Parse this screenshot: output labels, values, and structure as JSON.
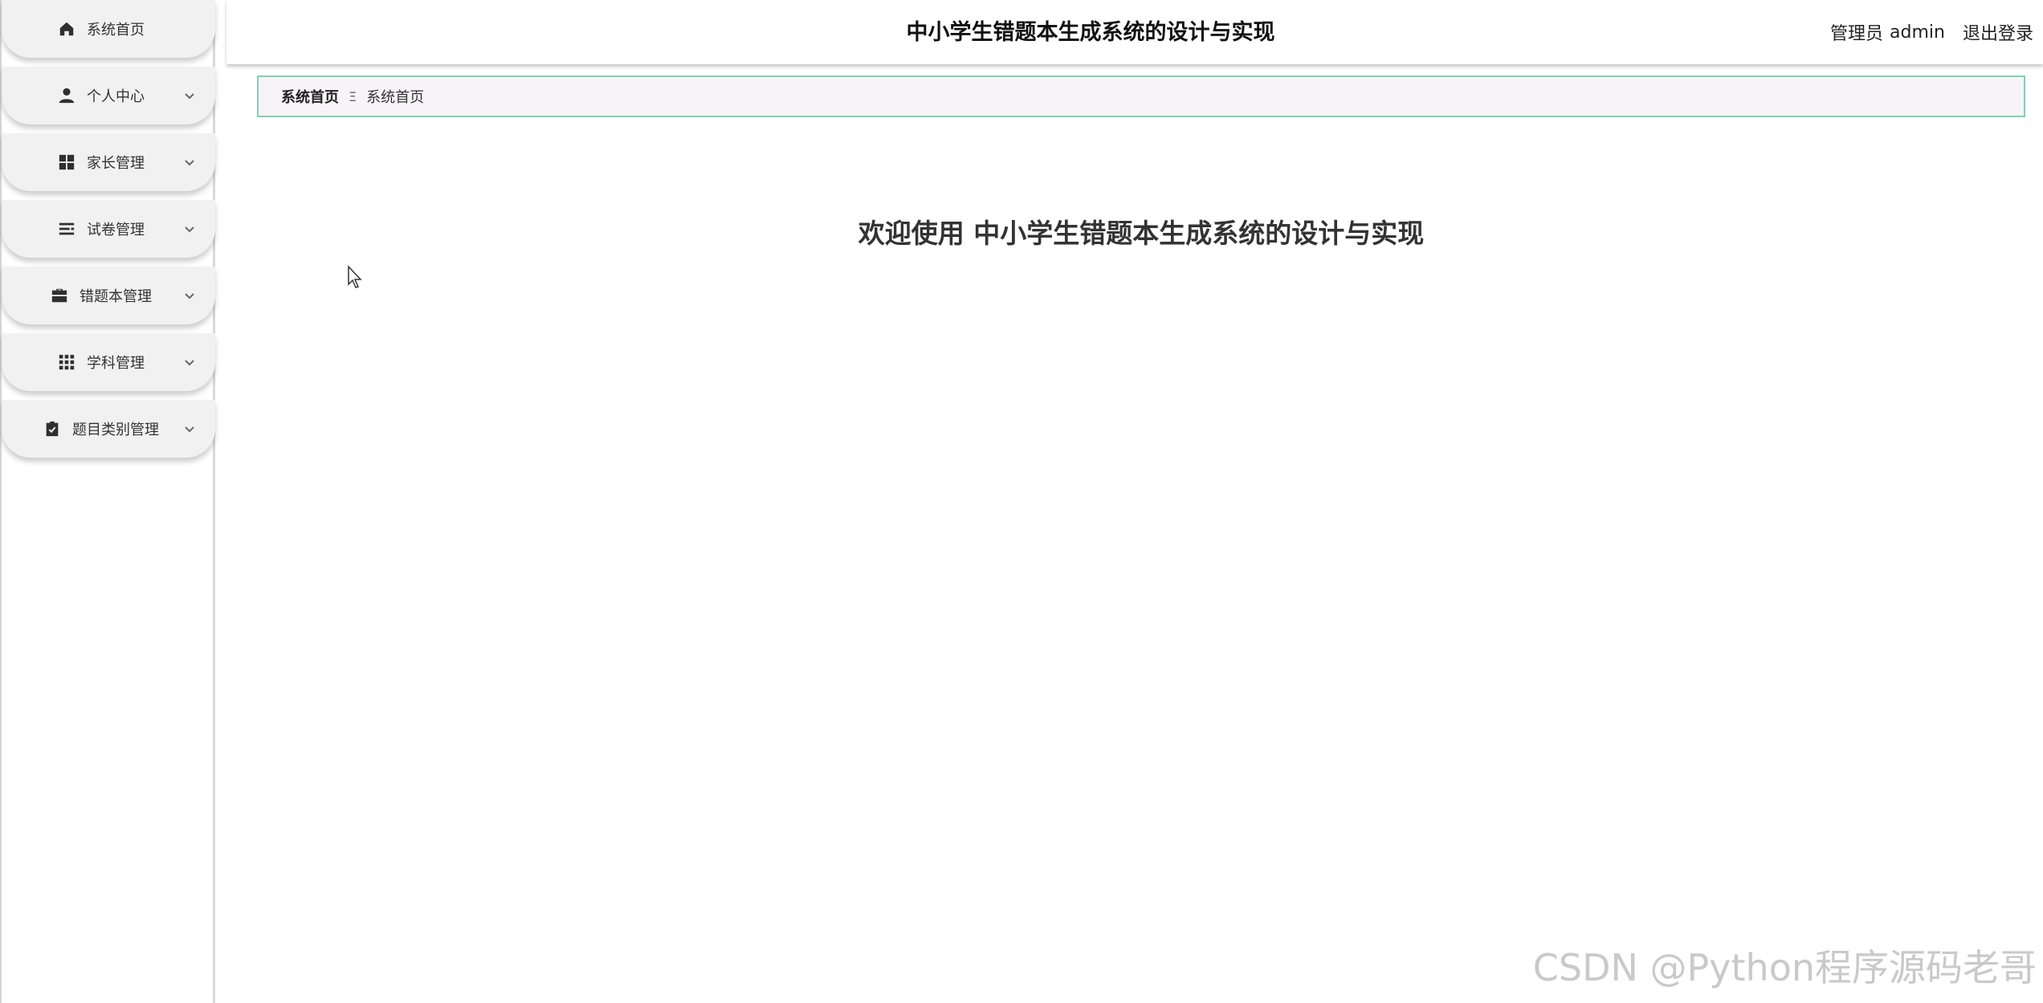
{
  "header": {
    "title": "中小学生错题本生成系统的设计与实现",
    "user_role": "管理员",
    "user_name": "admin",
    "logout_label": "退出登录"
  },
  "sidebar": {
    "items": [
      {
        "label": "系统首页",
        "icon": "home-icon",
        "has_chevron": false
      },
      {
        "label": "个人中心",
        "icon": "user-icon",
        "has_chevron": true
      },
      {
        "label": "家长管理",
        "icon": "grid-icon",
        "has_chevron": true
      },
      {
        "label": "试卷管理",
        "icon": "list-icon",
        "has_chevron": true
      },
      {
        "label": "错题本管理",
        "icon": "briefcase-icon",
        "has_chevron": true
      },
      {
        "label": "学科管理",
        "icon": "apps-icon",
        "has_chevron": true
      },
      {
        "label": "题目类别管理",
        "icon": "clipboard-check-icon",
        "has_chevron": true
      }
    ]
  },
  "breadcrumb": {
    "root": "系统首页",
    "separator": "Ξ",
    "current": "系统首页"
  },
  "main": {
    "welcome_text": "欢迎使用 中小学生错题本生成系统的设计与实现"
  },
  "watermark": "CSDN @Python程序源码老哥",
  "colors": {
    "breadcrumb_border": "#7fd1b4",
    "menu_background": "#f1f1f1"
  }
}
